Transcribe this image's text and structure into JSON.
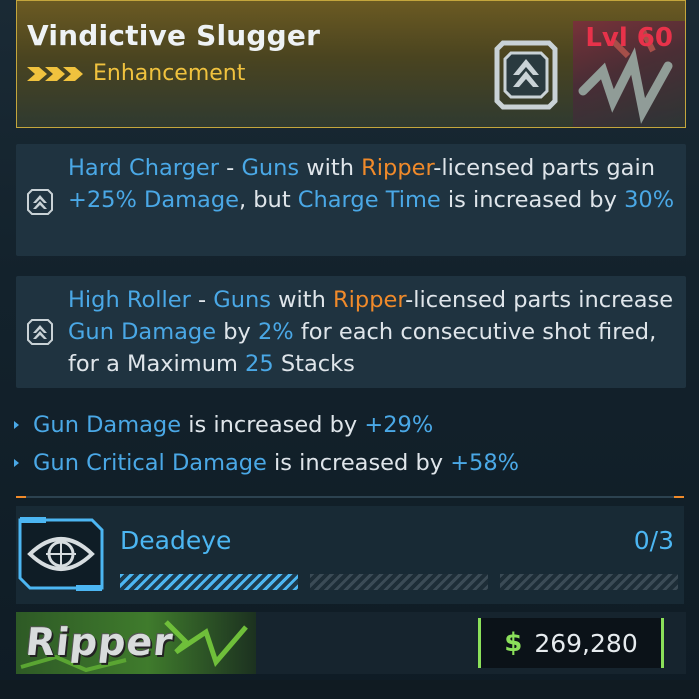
{
  "item": {
    "name": "Vindictive Slugger",
    "rarity_label": "Enhancement",
    "level": "Lvl 60"
  },
  "perks": [
    {
      "name": "Hard Charger",
      "parts": [
        " - ",
        "Guns",
        " with ",
        "Ripper",
        "-licensed parts gain ",
        "+25% Damage",
        ", but ",
        "Charge Time",
        " is increased by ",
        "30%"
      ]
    },
    {
      "name": "High Roller",
      "parts": [
        " - ",
        "Guns",
        " with ",
        "Ripper",
        "-licensed parts increase ",
        "Gun Damage",
        " by ",
        "2%",
        " for each consecutive shot fired, for a Maximum ",
        "25",
        " Stacks"
      ]
    }
  ],
  "stats": [
    {
      "name": "Gun Damage",
      "text": " is increased by ",
      "value": "+29%"
    },
    {
      "name": "Gun Critical Damage",
      "text": " is increased by ",
      "value": "+58%"
    }
  ],
  "skill": {
    "name": "Deadeye",
    "rank": "0/3",
    "rank_fill": 0
  },
  "manufacturer": {
    "label": "Ripper"
  },
  "price": {
    "icon": "dollar-icon",
    "value": "269,280"
  },
  "colors": {
    "accent_blue": "#4aa8e6",
    "accent_orange": "#f08a2a",
    "level_red": "#e8324a",
    "rarity_gold": "#f0c23e",
    "money_green": "#8be05a"
  }
}
